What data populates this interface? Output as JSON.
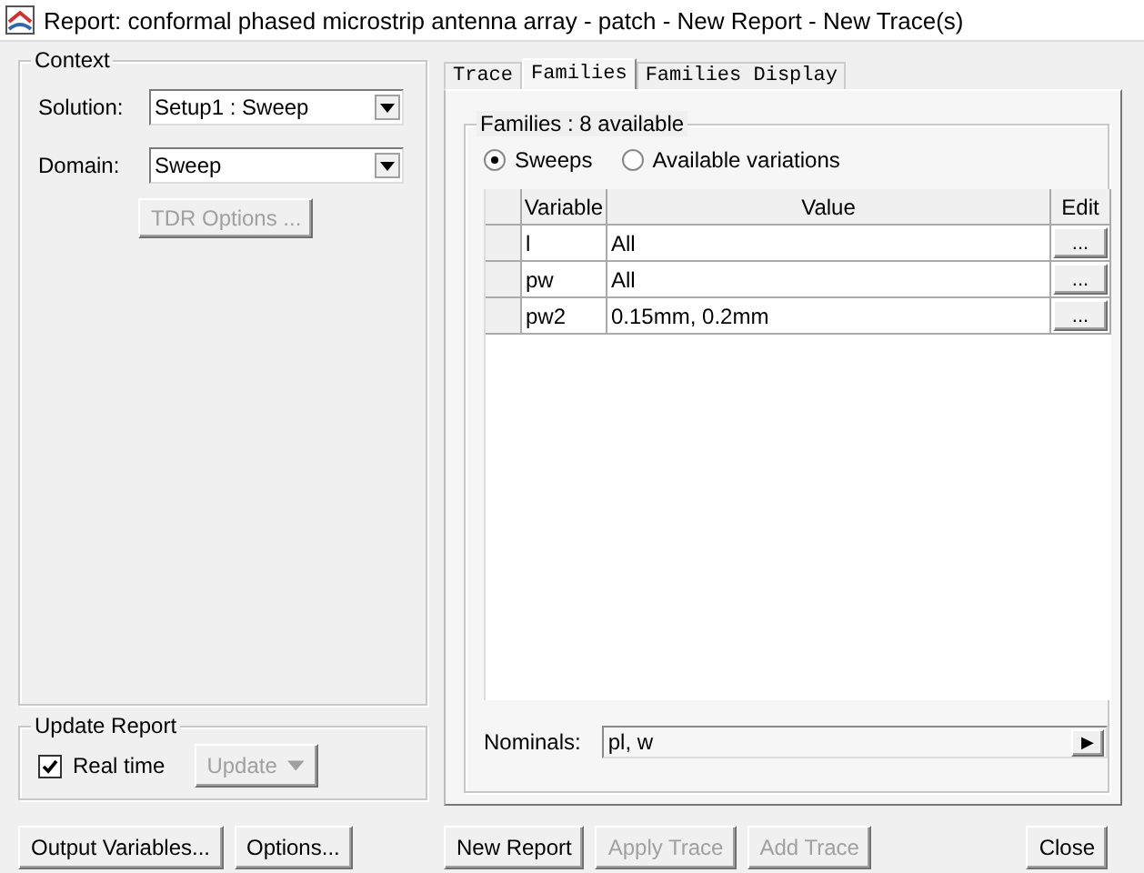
{
  "window": {
    "title": "Report: conformal phased microstrip antenna array - patch - New Report - New Trace(s)"
  },
  "context": {
    "title": "Context",
    "fields": [
      {
        "label": "Solution:",
        "value": "Setup1 : Sweep"
      },
      {
        "label": "Domain:",
        "value": "Sweep"
      }
    ],
    "tdr_button": {
      "label": "TDR Options ...",
      "disabled": true
    }
  },
  "update_report": {
    "title": "Update Report",
    "real_time": {
      "label": "Real time",
      "checked": true
    },
    "update_button": {
      "label": "Update",
      "disabled": true
    }
  },
  "left_buttons": [
    {
      "label": "Output Variables...",
      "disabled": false
    },
    {
      "label": "Options...",
      "disabled": false
    }
  ],
  "tabs": [
    {
      "label": "Trace",
      "selected": false
    },
    {
      "label": "Families",
      "selected": true
    },
    {
      "label": "Families Display",
      "selected": false
    }
  ],
  "families": {
    "title": "Families : 8 available",
    "options": [
      {
        "label": "Sweeps",
        "selected": true
      },
      {
        "label": "Available variations",
        "selected": false
      }
    ],
    "columns": [
      "Variable",
      "Value",
      "Edit"
    ],
    "rows": [
      {
        "variable": "l",
        "value": "All",
        "edit": "..."
      },
      {
        "variable": "pw",
        "value": "All",
        "edit": "..."
      },
      {
        "variable": "pw2",
        "value": "0.15mm, 0.2mm",
        "edit": "..."
      }
    ],
    "nominals": {
      "label": "Nominals:",
      "value": "pl, w",
      "arrow": "▶"
    }
  },
  "bottom_buttons": [
    {
      "label": "New Report",
      "disabled": false
    },
    {
      "label": "Apply Trace",
      "disabled": true
    },
    {
      "label": "Add Trace",
      "disabled": true
    },
    {
      "label": "Close",
      "disabled": false
    }
  ]
}
